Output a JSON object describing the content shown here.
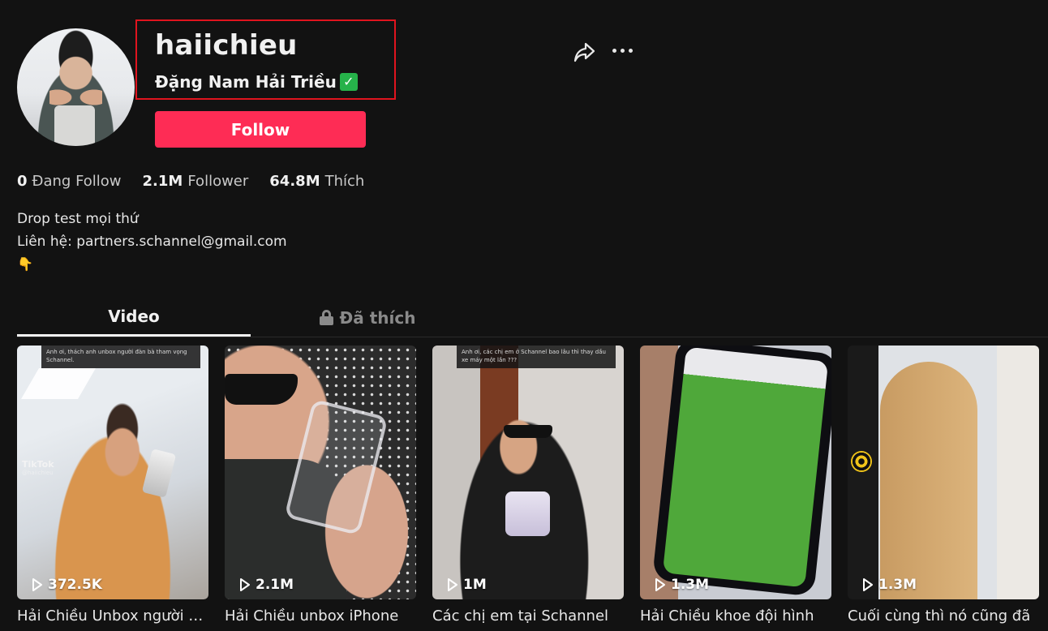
{
  "profile": {
    "username": "haiichieu",
    "display_name": "Đặng Nam Hải Triều",
    "verified_badge": "✓",
    "follow_label": "Follow"
  },
  "actions": {
    "share_icon": "share-icon",
    "more_icon": "more-icon"
  },
  "stats": [
    {
      "value": "0",
      "label": "Đang Follow"
    },
    {
      "value": "2.1M",
      "label": "Follower"
    },
    {
      "value": "64.8M",
      "label": "Thích"
    }
  ],
  "bio": {
    "line1": "Drop test mọi thứ",
    "line2": "Liên hệ: partners.schannel@gmail.com",
    "line3": "👇"
  },
  "tabs": [
    {
      "label": "Video",
      "active": true
    },
    {
      "label": "Đã thích",
      "active": false,
      "locked": true
    }
  ],
  "videos": [
    {
      "views": "372.5K",
      "title": "Hải Chiều Unbox người đàn bà tham vọng Schannel",
      "caption": "Anh ơi, thách anh unbox người đàn bà tham vọng Schannel.",
      "watermark": "TikTok",
      "watermark_handle": "@haiichieu"
    },
    {
      "views": "2.1M",
      "title": "Hải Chiều unbox iPhone"
    },
    {
      "views": "1M",
      "title": "Các chị em tại Schannel",
      "caption": "Anh ơi, các chị em ở Schannel bao lâu thì thay dầu xe máy một lần ???"
    },
    {
      "views": "1.3M",
      "title": "Hải Chiều khoe đội hình"
    },
    {
      "views": "1.3M",
      "title": "Cuối cùng thì nó cũng đã"
    }
  ],
  "colors": {
    "background": "#121212",
    "accent": "#fe2c55",
    "highlight_box": "#e0141e",
    "verified": "#26b24a"
  }
}
